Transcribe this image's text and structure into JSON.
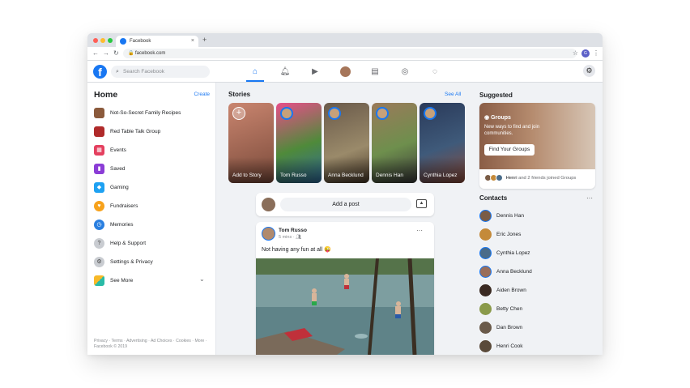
{
  "browser": {
    "tab_title": "Facebook",
    "tab_close": "×",
    "new_tab": "+",
    "back": "←",
    "forward": "→",
    "reload": "↻",
    "url": "facebook.com",
    "star": "☆",
    "profile_initial": "G",
    "menu": "⋮",
    "colors": {
      "close": "#ff5f57",
      "minimize": "#febc2e",
      "maximize": "#28c840"
    }
  },
  "topnav": {
    "logo": "f",
    "search_placeholder": "Search Facebook",
    "icons": [
      "home-icon",
      "bell-icon",
      "video-icon",
      "avatar",
      "marketplace-icon",
      "groups-icon",
      "messenger-icon",
      "gear-icon"
    ],
    "accent": "#1877f2"
  },
  "left": {
    "heading": "Home",
    "create": "Create",
    "items": [
      {
        "label": "Not-So-Secret Family Recipes",
        "icon": "group-avatar",
        "color": "#8b5a3c"
      },
      {
        "label": "Red Table Talk Group",
        "icon": "group-avatar",
        "color": "#b02a2a"
      },
      {
        "label": "Events",
        "icon": "calendar-icon",
        "color": "#e4405f"
      },
      {
        "label": "Saved",
        "icon": "bookmark-icon",
        "color": "#8b3dd6"
      },
      {
        "label": "Gaming",
        "icon": "gaming-icon",
        "color": "#1ea1f2"
      },
      {
        "label": "Fundraisers",
        "icon": "heart-icon",
        "color": "#f7a21b"
      },
      {
        "label": "Memories",
        "icon": "clock-icon",
        "color": "#2a7fe0"
      },
      {
        "label": "Help & Support",
        "icon": "question-icon",
        "color": "#8a8d91"
      },
      {
        "label": "Settings & Privacy",
        "icon": "gear-icon",
        "color": "#8a8d91"
      },
      {
        "label": "See More",
        "icon": "grid-icon",
        "color": "#f7b928"
      }
    ],
    "footer": "Privacy · Terms · Advertising · Ad Choices · Cookies · More · Facebook © 2019"
  },
  "stories": {
    "title": "Stories",
    "see_all": "See All",
    "cards": [
      {
        "name": "Add to Story",
        "bg": "#c9856f"
      },
      {
        "name": "Tom Russo",
        "bg": "#4f8a3a"
      },
      {
        "name": "Anna Becklund",
        "bg": "#7a6a5a"
      },
      {
        "name": "Dennis Han",
        "bg": "#6e8f4d"
      },
      {
        "name": "Cynthia Lopez",
        "bg": "#3f5a7a"
      }
    ]
  },
  "composer": {
    "placeholder": "Add a post"
  },
  "post": {
    "author": "Tom Russo",
    "time": "5 mins · ",
    "audience_icon": "friends-icon",
    "text": "Not having any fun at all 😜",
    "more": "···"
  },
  "right": {
    "suggested": "Suggested",
    "groups": {
      "tag": "Groups",
      "desc": "New ways to find and join communities.",
      "button": "Find Your Groups",
      "footer_names": "Henri",
      "footer_rest": " and 2 friends joined Groups"
    },
    "contacts_title": "Contacts",
    "contacts_more": "···",
    "contacts": [
      {
        "name": "Dennis Han",
        "color": "#7a5c46"
      },
      {
        "name": "Eric Jones",
        "color": "#c48a3a"
      },
      {
        "name": "Cynthia Lopez",
        "color": "#4a6c8a"
      },
      {
        "name": "Anna Becklund",
        "color": "#9a6e5a"
      },
      {
        "name": "Aiden Brown",
        "color": "#3a2a22"
      },
      {
        "name": "Betty Chen",
        "color": "#8a9a4a"
      },
      {
        "name": "Dan Brown",
        "color": "#6a5a4a"
      },
      {
        "name": "Henri Cook",
        "color": "#5a4a3a"
      }
    ]
  }
}
